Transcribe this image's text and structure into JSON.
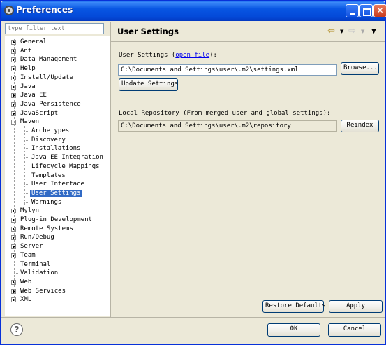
{
  "window": {
    "title": "Preferences"
  },
  "filter": {
    "placeholder": "type filter text"
  },
  "tree": [
    {
      "label": "General",
      "level": 0,
      "expander": "plus"
    },
    {
      "label": "Ant",
      "level": 0,
      "expander": "plus"
    },
    {
      "label": "Data Management",
      "level": 0,
      "expander": "plus"
    },
    {
      "label": "Help",
      "level": 0,
      "expander": "plus"
    },
    {
      "label": "Install/Update",
      "level": 0,
      "expander": "plus"
    },
    {
      "label": "Java",
      "level": 0,
      "expander": "plus"
    },
    {
      "label": "Java EE",
      "level": 0,
      "expander": "plus"
    },
    {
      "label": "Java Persistence",
      "level": 0,
      "expander": "plus"
    },
    {
      "label": "JavaScript",
      "level": 0,
      "expander": "plus"
    },
    {
      "label": "Maven",
      "level": 0,
      "expander": "minus"
    },
    {
      "label": "Archetypes",
      "level": 1
    },
    {
      "label": "Discovery",
      "level": 1
    },
    {
      "label": "Installations",
      "level": 1
    },
    {
      "label": "Java EE Integration",
      "level": 1
    },
    {
      "label": "Lifecycle Mappings",
      "level": 1
    },
    {
      "label": "Templates",
      "level": 1
    },
    {
      "label": "User Interface",
      "level": 1
    },
    {
      "label": "User Settings",
      "level": 1,
      "selected": true
    },
    {
      "label": "Warnings",
      "level": 1
    },
    {
      "label": "Mylyn",
      "level": 0,
      "expander": "plus"
    },
    {
      "label": "Plug-in Development",
      "level": 0,
      "expander": "plus"
    },
    {
      "label": "Remote Systems",
      "level": 0,
      "expander": "plus"
    },
    {
      "label": "Run/Debug",
      "level": 0,
      "expander": "plus"
    },
    {
      "label": "Server",
      "level": 0,
      "expander": "plus"
    },
    {
      "label": "Team",
      "level": 0,
      "expander": "plus"
    },
    {
      "label": "Terminal",
      "level": 0
    },
    {
      "label": "Validation",
      "level": 0
    },
    {
      "label": "Web",
      "level": 0,
      "expander": "plus"
    },
    {
      "label": "Web Services",
      "level": 0,
      "expander": "plus"
    },
    {
      "label": "XML",
      "level": 0,
      "expander": "plus"
    }
  ],
  "page": {
    "title": "User Settings",
    "user_settings_label": "User Settings (",
    "open_file_link": "open file",
    "user_settings_label_end": "):",
    "user_settings_path": "C:\\Documents and Settings\\user\\.m2\\settings.xml",
    "browse_button": "Browse...",
    "update_button": "Update Settings",
    "local_repo_label": "Local Repository (From merged user and global settings):",
    "local_repo_path": "C:\\Documents and Settings\\user\\.m2\\repository",
    "reindex_button": "Reindex",
    "restore_defaults_button": "Restore Defaults",
    "apply_button": "Apply"
  },
  "footer": {
    "help_glyph": "?",
    "ok_button": "OK",
    "cancel_button": "Cancel"
  },
  "colors": {
    "title_bar": "#0449d8",
    "selection": "#316ac5",
    "link": "#0000ee"
  }
}
